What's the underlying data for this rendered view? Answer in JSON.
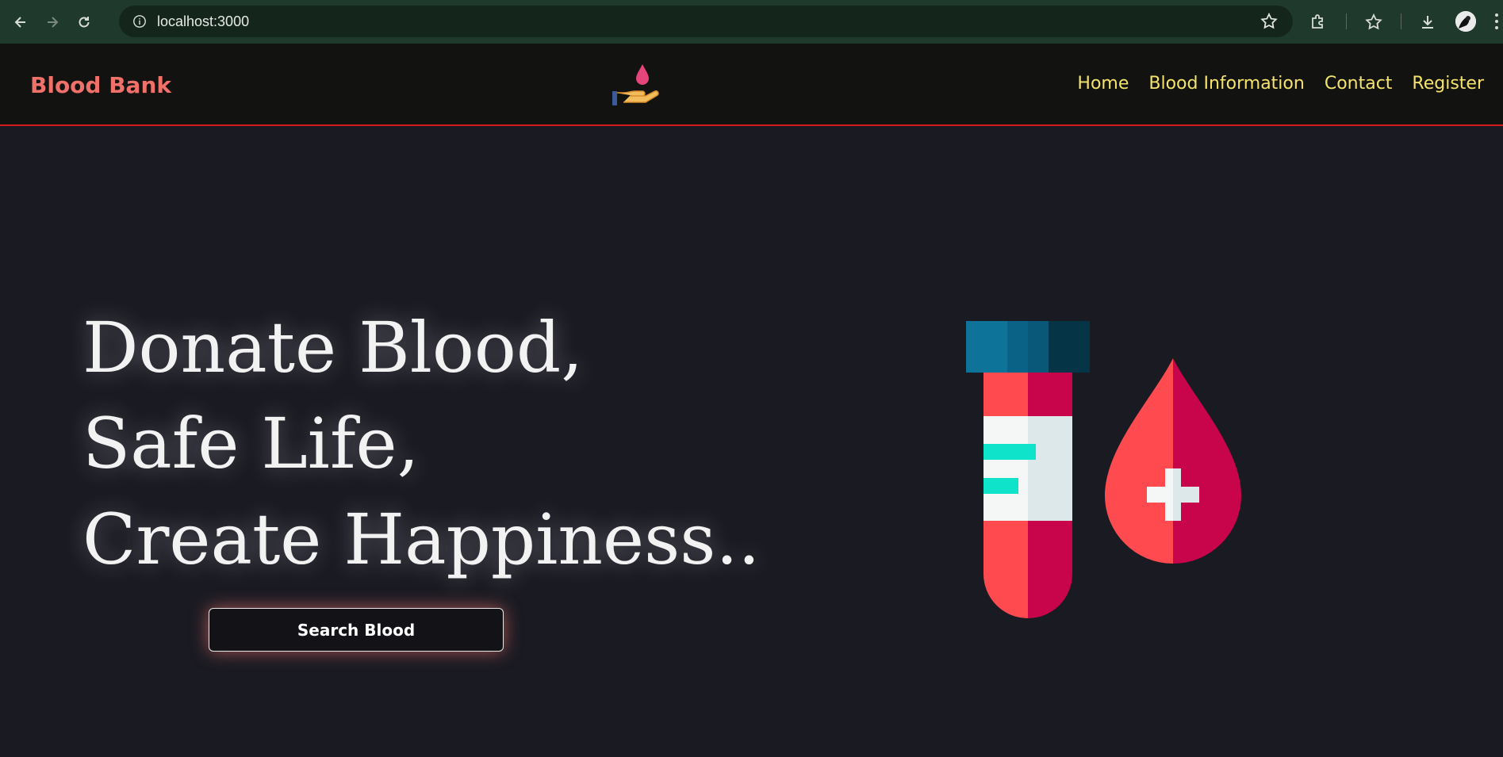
{
  "browser": {
    "url": "localhost:3000"
  },
  "site": {
    "brand": "Blood Bank",
    "nav": [
      "Home",
      "Blood Information",
      "Contact",
      "Register"
    ]
  },
  "hero": {
    "lines": [
      "Donate Blood,",
      "Safe Life,",
      "Create Happiness.."
    ],
    "button_label": "Search Blood"
  },
  "icons": {
    "logo": "hand-holding-blood-drop-icon",
    "illustration": "blood-test-tube-and-drop-icon"
  },
  "colors": {
    "brand": "#f0706a",
    "nav_link": "#f5e36a",
    "header_border": "#d41a1a",
    "page_bg": "#1a1a22"
  }
}
